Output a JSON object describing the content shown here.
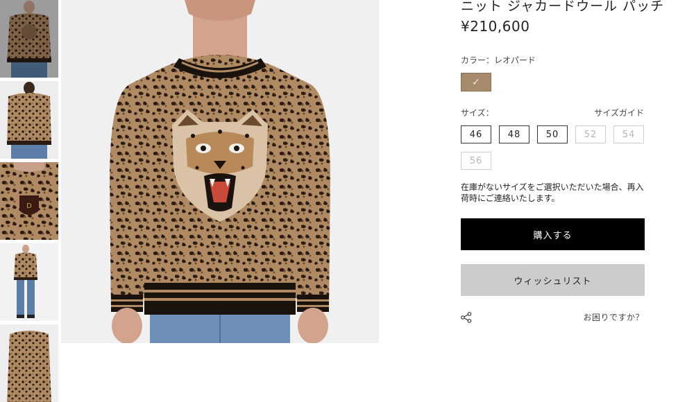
{
  "product": {
    "title": "ニット ジャカードウール パッチ",
    "price": "¥210,600"
  },
  "color": {
    "label": "カラー：レオパード",
    "selected_swatch_color": "#a58a6c",
    "check_mark": "✓"
  },
  "size": {
    "label": "サイズ：",
    "guide_link": "サイズガイド",
    "options": [
      {
        "value": "46",
        "available": true
      },
      {
        "value": "48",
        "available": true
      },
      {
        "value": "50",
        "available": true
      },
      {
        "value": "52",
        "available": false
      },
      {
        "value": "54",
        "available": false
      },
      {
        "value": "56",
        "available": false
      }
    ]
  },
  "notice": "在庫がないサイズをご選択いただいた場合、再入荷時にご連絡いたします。",
  "buttons": {
    "buy": "購入する",
    "wishlist": "ウィッシュリスト"
  },
  "footer": {
    "share_icon": "share-icon",
    "help": "お困りですか？"
  },
  "thumbnails": [
    "front-view",
    "back-view",
    "detail-patch",
    "full-outfit",
    "close-up"
  ],
  "colors": {
    "buy_bg": "#000000",
    "wishlist_bg": "#cccccc",
    "leopard_base": "#b08a63"
  }
}
